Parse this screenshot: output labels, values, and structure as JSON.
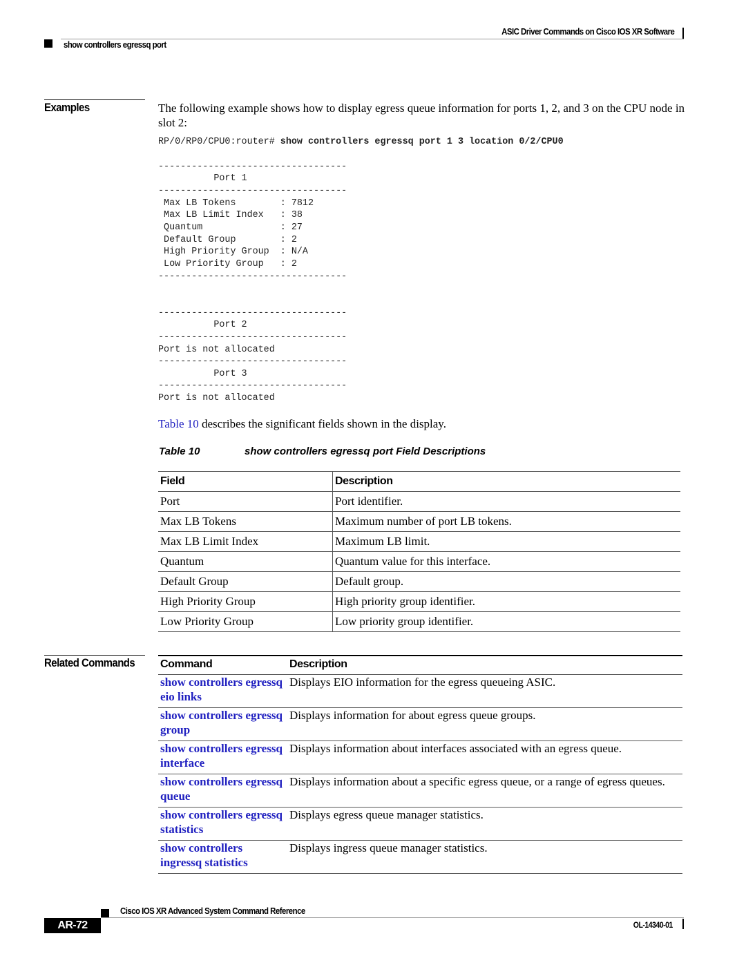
{
  "header": {
    "chapter": "ASIC Driver Commands on Cisco IOS XR Software",
    "command": "show controllers egressq port"
  },
  "examples": {
    "title": "Examples",
    "intro": "The following example shows how to display egress queue information for ports 1, 2, and 3 on the CPU node in slot 2:",
    "prompt": "RP/0/RP0/CPU0:router#",
    "command": "show controllers egressq port 1 3 location 0/2/CPU0",
    "output": "\n----------------------------------\n          Port 1\n----------------------------------\n Max LB Tokens        : 7812\n Max LB Limit Index   : 38\n Quantum              : 27\n Default Group        : 2\n High Priority Group  : N/A\n Low Priority Group   : 2\n----------------------------------\n\n\n----------------------------------\n          Port 2\n----------------------------------\nPort is not allocated\n----------------------------------\n          Port 3\n----------------------------------\nPort is not allocated",
    "ref_link": "Table 10",
    "ref_text": " describes the significant fields shown in the display."
  },
  "field_table": {
    "caption_num": "Table 10",
    "caption_title": "show controllers egressq port Field Descriptions",
    "headers": [
      "Field",
      "Description"
    ],
    "rows": [
      [
        "Port",
        "Port identifier."
      ],
      [
        "Max LB Tokens",
        "Maximum number of port LB tokens."
      ],
      [
        "Max LB Limit Index",
        "Maximum LB limit."
      ],
      [
        "Quantum",
        "Quantum value for this interface."
      ],
      [
        "Default Group",
        "Default group."
      ],
      [
        "High Priority Group",
        "High priority group identifier."
      ],
      [
        "Low Priority Group",
        "Low priority group identifier."
      ]
    ]
  },
  "related": {
    "title": "Related Commands",
    "headers": [
      "Command",
      "Description"
    ],
    "rows": [
      [
        "show controllers egressq eio links",
        "Displays EIO information for the egress queueing ASIC."
      ],
      [
        "show controllers egressq group",
        "Displays information for about egress queue groups."
      ],
      [
        "show controllers egressq interface",
        "Displays information about interfaces associated with an egress queue."
      ],
      [
        "show controllers egressq queue",
        "Displays information about a specific egress queue, or a range of egress queues."
      ],
      [
        "show controllers egressq statistics",
        "Displays egress queue manager statistics."
      ],
      [
        "show controllers ingressq statistics",
        "Displays ingress queue manager statistics."
      ]
    ]
  },
  "footer": {
    "book": "Cisco IOS XR Advanced System Command Reference",
    "page": "AR-72",
    "doc_id": "OL-14340-01"
  }
}
